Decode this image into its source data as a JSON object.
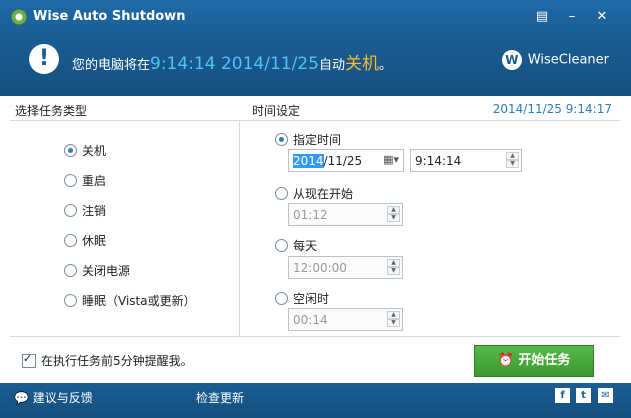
{
  "titlebar": {
    "title": "Wise Auto Shutdown"
  },
  "banner": {
    "prefix": "您的电脑将在",
    "time": "9:14:14 2014/11/25",
    "mid": "自动",
    "action": "关机",
    "suffix": "。",
    "brand": "WiseCleaner",
    "brand_icon_letter": "W"
  },
  "left": {
    "heading": "选择任务类型",
    "tasks": [
      "关机",
      "重启",
      "注销",
      "休眠",
      "关闭电源",
      "睡眠（Vista或更新）"
    ],
    "selected_index": 0
  },
  "right": {
    "heading": "时间设定",
    "current_time": "2014/11/25 9:14:17",
    "specified_label": "指定时间",
    "date_value_sel": "2014",
    "date_value_rest": "/11/25",
    "time_value": "9:14:14",
    "from_now_label": "从现在开始",
    "from_now_value": "01:12",
    "daily_label": "每天",
    "daily_value": "12:00:00",
    "idle_label": "空闲时",
    "idle_value": "00:14"
  },
  "bottom": {
    "remind_label": "在执行任务前5分钟提醒我。",
    "start_label": "开始任务"
  },
  "footer": {
    "feedback": "建议与反馈",
    "update": "检查更新",
    "social": [
      "f",
      "t",
      "✉"
    ]
  },
  "colors": {
    "accent": "#1a5e96",
    "time_blue": "#4fc3f7",
    "action_orange": "#ffb733",
    "button_green": "#3a9a30"
  }
}
